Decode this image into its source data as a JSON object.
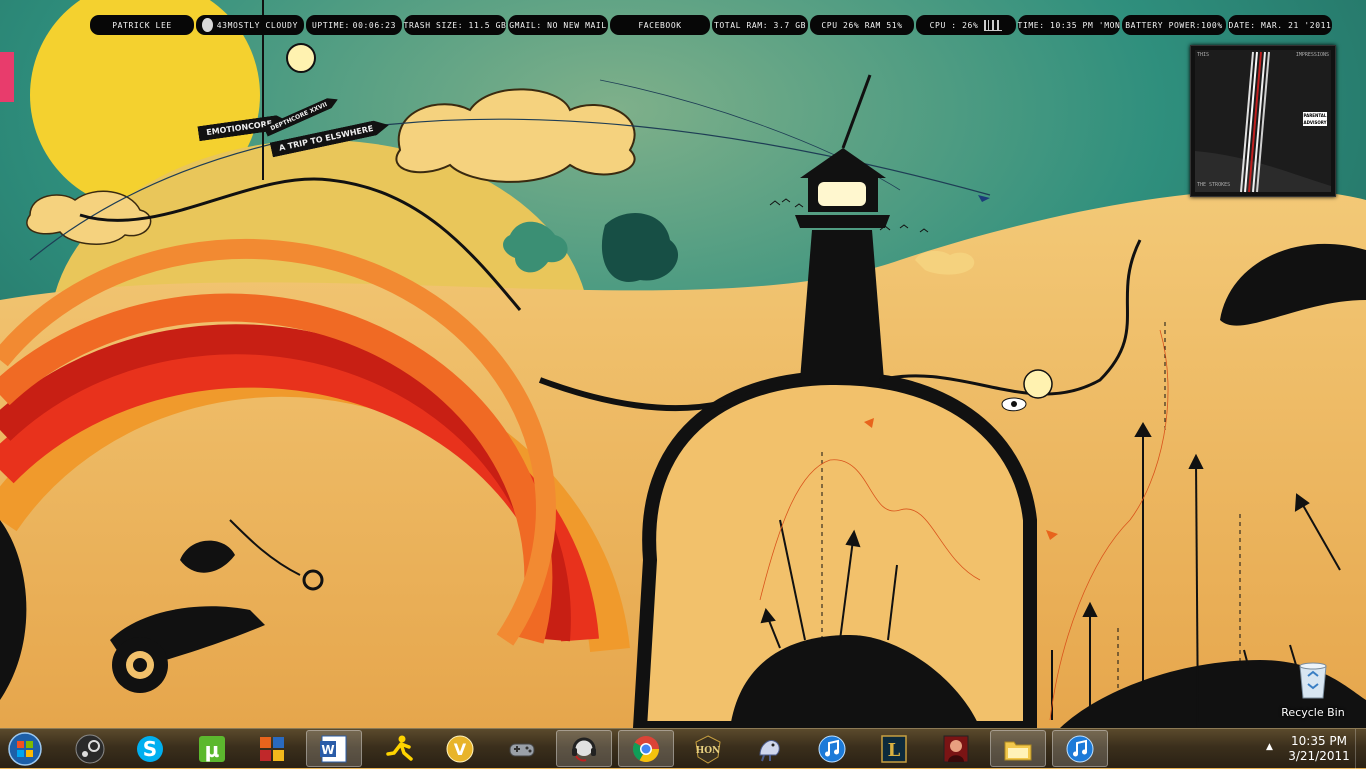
{
  "statusbar": {
    "user": "PATRICK LEE",
    "weather": "43MOSTLY CLOUDY",
    "uptime_label": "UPTIME:",
    "uptime_value": "00:06:23",
    "trash": "TRASH SIZE: 11.5 GB",
    "gmail": "GMAIL: NO NEW MAIL",
    "facebook": "FACEBOOK",
    "ram_total": "TOTAL RAM: 3.7 GB",
    "cpu_ram": "CPU 26% RAM 51%",
    "cpu": "CPU : 26%",
    "time": "TIME: 10:35 PM 'MON",
    "battery": "BATTERY POWER:100%",
    "date": "DATE: MAR. 21 '2011"
  },
  "album": {
    "label_left": "THIS",
    "label_right": "IMPRESSIONS",
    "band": "THE STROKES",
    "advisory": "PARENTAL ADVISORY"
  },
  "signs": {
    "sign1": "EMOTIONCORE",
    "sign2": "DEPTHCORE XXVII",
    "sign3": "A TRIP TO ELSWHERE"
  },
  "desktop": {
    "recycle_bin": "Recycle Bin"
  },
  "taskbar": {
    "items": [
      {
        "name": "steam"
      },
      {
        "name": "skype"
      },
      {
        "name": "utorrent"
      },
      {
        "name": "microsoft-office"
      },
      {
        "name": "microsoft-word"
      },
      {
        "name": "aim"
      },
      {
        "name": "ventrilo"
      },
      {
        "name": "controller"
      },
      {
        "name": "headset"
      },
      {
        "name": "google-chrome"
      },
      {
        "name": "heroes-of-newerth"
      },
      {
        "name": "pidgin"
      },
      {
        "name": "itunes"
      },
      {
        "name": "league-of-legends"
      },
      {
        "name": "game-client"
      },
      {
        "name": "windows-explorer"
      },
      {
        "name": "itunes"
      }
    ],
    "clock_time": "10:35 PM",
    "clock_date": "3/21/2011"
  },
  "colors": {
    "sky_teal": "#2e8e7e",
    "sun_yellow": "#f3d23a",
    "land_orange": "#e9b458",
    "rainbow_red": "#e8321c",
    "silhouette": "#111111",
    "taskbar": "#3b2f1c"
  }
}
